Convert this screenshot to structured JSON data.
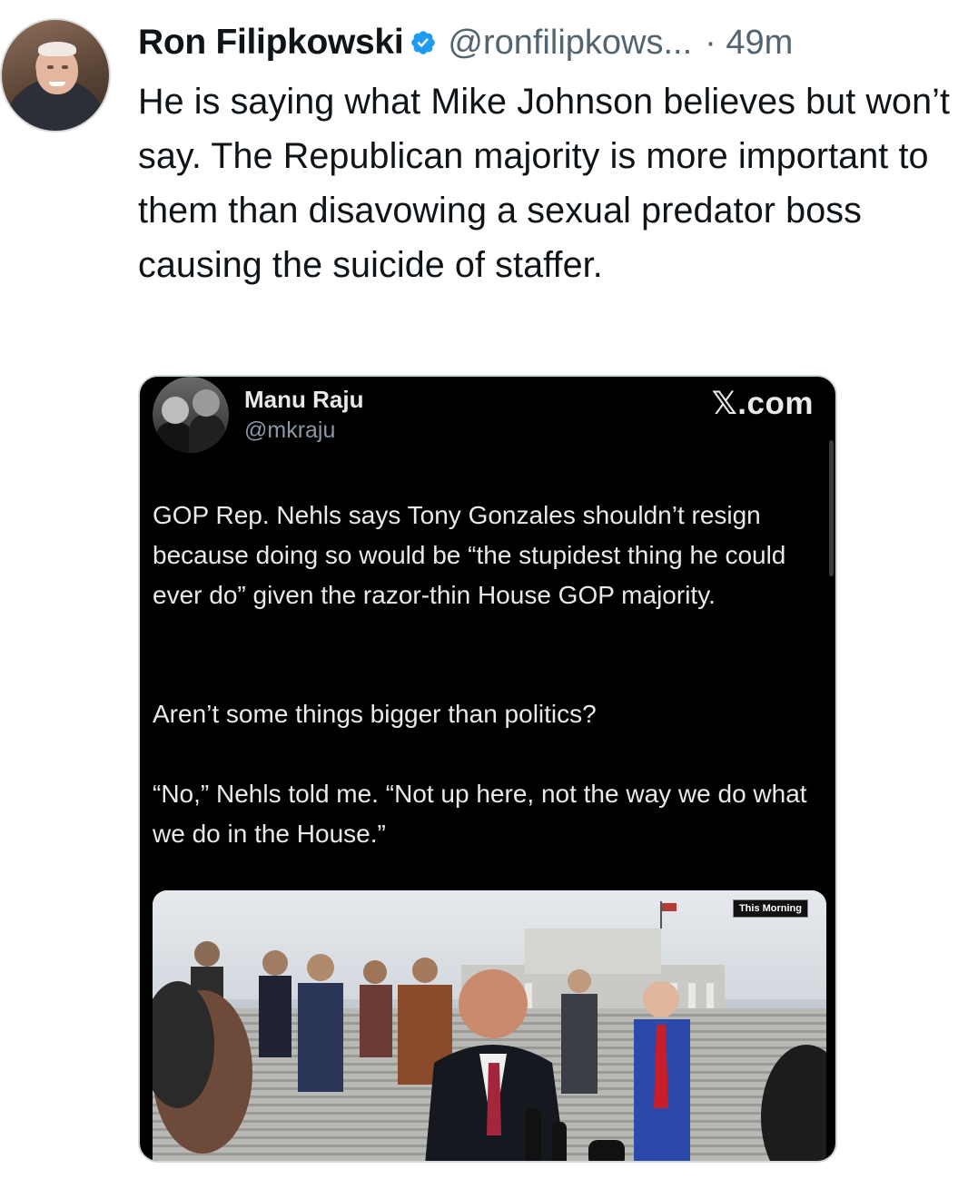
{
  "author": {
    "name": "Ron Filipkowski",
    "handle": "@ronfilipkows...",
    "time": "· 49m"
  },
  "tweet_text": "He is saying what Mike Johnson believes but won’t say. The Republican majority is more important to them than disavowing a sexual predator boss causing the suicide of staffer.",
  "quoted": {
    "name": "Manu Raju",
    "handle": "@mkraju",
    "brand": "𝕏.com",
    "paragraph1": "GOP Rep. Nehls says Tony Gonzales shouldn’t resign because doing so would be “the stupidest thing he could ever do” given the razor-thin House GOP majority.",
    "paragraph2": "Aren’t some things bigger than politics?",
    "paragraph3": "“No,” Nehls told me. “Not up here, not the way we do what we do in the House.”",
    "media_badge": "This Morning"
  },
  "colors": {
    "verified": "#1d9bf0",
    "card_bg": "#000000",
    "text_secondary": "#536471"
  }
}
